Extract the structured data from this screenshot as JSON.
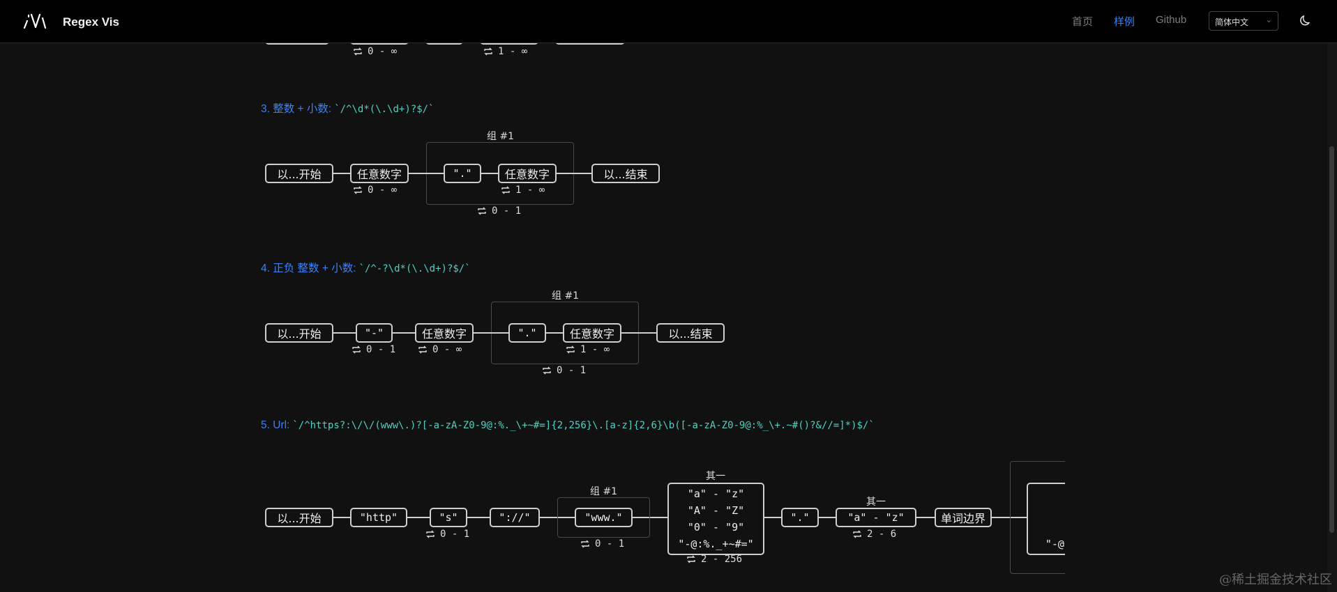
{
  "header": {
    "app_title": "Regex Vis",
    "nav": {
      "home": "首页",
      "examples": "样例",
      "github": "Github"
    },
    "language": "简体中文"
  },
  "prev_example": {
    "quant_a": "0 - ∞",
    "quant_b": "1 - ∞"
  },
  "examples": [
    {
      "title": "3. 整数 + 小数:",
      "regex": "`/^\\d*(\\.\\d+)?$/`",
      "nodes": {
        "start": "以...开始",
        "digit1": "任意数字",
        "dot": "\".\"",
        "digit2": "任意数字",
        "end": "以...结束"
      },
      "group_label": "组 #1",
      "quants": {
        "digit1": "0 - ∞",
        "digit2": "1 - ∞",
        "group": "0 - 1"
      }
    },
    {
      "title": "4. 正负 整数 + 小数:",
      "regex": "`/^-?\\d*(\\.\\d+)?$/`",
      "nodes": {
        "start": "以...开始",
        "minus": "\"-\"",
        "digit1": "任意数字",
        "dot": "\".\"",
        "digit2": "任意数字",
        "end": "以...结束"
      },
      "group_label": "组 #1",
      "quants": {
        "minus": "0 - 1",
        "digit1": "0 - ∞",
        "digit2": "1 - ∞",
        "group": "0 - 1"
      }
    },
    {
      "title": "5. Url:",
      "regex": "`/^https?:\\/\\/(www\\.)?[-a-zA-Z0-9@:%._\\+~#=]{2,256}\\.[a-z]{2,6}\\b([-a-zA-Z0-9@:%_\\+.~#()?&//=]*)$/`",
      "nodes": {
        "start": "以...开始",
        "http": "\"http\"",
        "s": "\"s\"",
        "colon_slash": "\"://\"",
        "www": "\"www.\"",
        "set1": [
          "\"a\" - \"z\"",
          "\"A\" - \"Z\"",
          "\"0\" - \"9\"",
          "\"-@:%._+~#=\""
        ],
        "dot": "\".\"",
        "az": "\"a\" - \"z\"",
        "wb": "单词边界",
        "set2": [
          "\"",
          "\"",
          "\"",
          "\"-@:%"
        ]
      },
      "group_label": "组 #1",
      "choice_label_1": "其一",
      "choice_label_2": "其一",
      "quants": {
        "s": "0 - 1",
        "group": "0 - 1",
        "set1": "2 - 256",
        "az": "2 - 6"
      }
    }
  ],
  "watermark": "@稀土掘金技术社区"
}
